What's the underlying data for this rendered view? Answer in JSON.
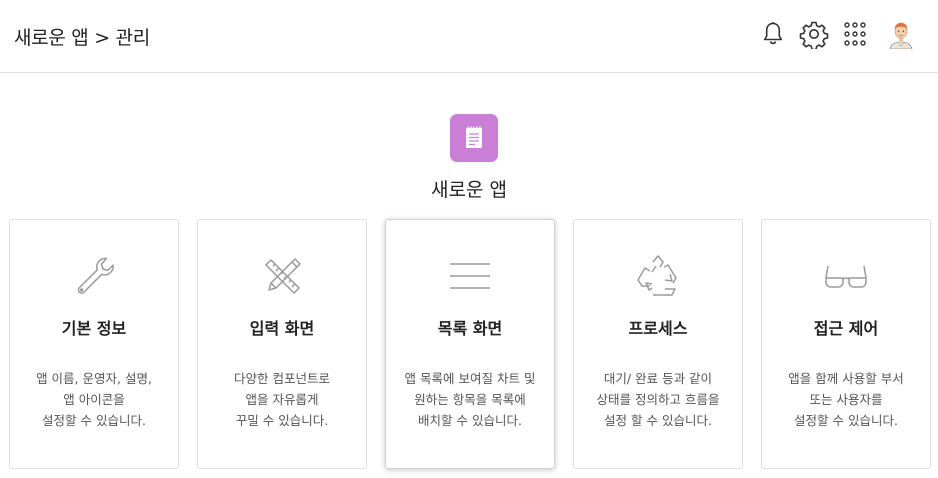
{
  "header": {
    "breadcrumb": "새로운 앱 > 관리",
    "icons": [
      "bell-icon",
      "gear-icon",
      "apps-grid-icon",
      "user-avatar"
    ]
  },
  "app": {
    "title": "새로운 앱",
    "icon": "document-icon",
    "icon_color": "#c97fd6"
  },
  "cards": [
    {
      "icon": "wrench-icon",
      "title": "기본 정보",
      "desc": [
        "앱 이름, 운영자, 설명,",
        "앱 아이콘을",
        "설정할 수 있습니다."
      ]
    },
    {
      "icon": "pencil-ruler-icon",
      "title": "입력 화면",
      "desc": [
        "다양한 컴포넌트로",
        "앱을 자유롭게",
        "꾸밀 수 있습니다."
      ]
    },
    {
      "icon": "list-lines-icon",
      "title": "목록 화면",
      "desc": [
        "앱 목록에 보여질 차트 및",
        "원하는 항목을 목록에",
        "배치할 수 있습니다."
      ]
    },
    {
      "icon": "recycle-icon",
      "title": "프로세스",
      "desc": [
        "대기/ 완료 등과 같이",
        "상태를 정의하고 흐름을",
        "설정 할 수 있습니다."
      ]
    },
    {
      "icon": "glasses-icon",
      "title": "접근 제어",
      "desc": [
        "앱을 함께 사용할 부서",
        "또는 사용자를",
        "설정할 수 있습니다."
      ]
    }
  ]
}
